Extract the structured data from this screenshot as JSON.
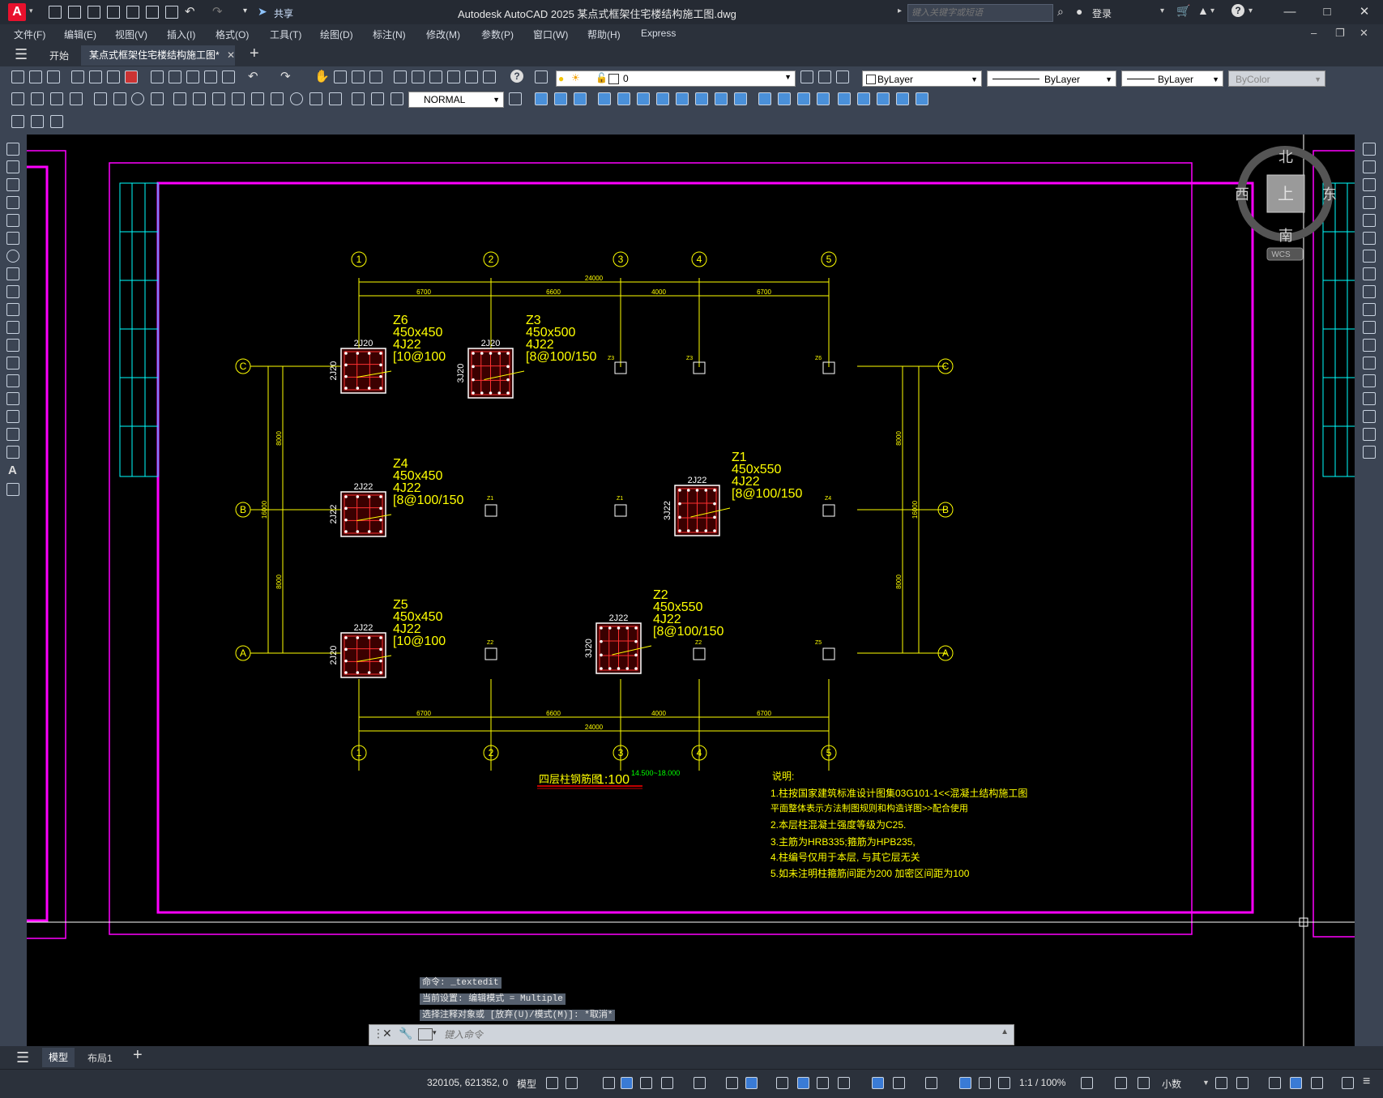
{
  "titlebar": {
    "app_logo": "A",
    "share_label": "共享",
    "title": "Autodesk AutoCAD 2025    某点式框架住宅楼结构施工图.dwg",
    "search_placeholder": "键入关键字或短语",
    "login_label": "登录"
  },
  "menu": [
    "文件(F)",
    "编辑(E)",
    "视图(V)",
    "插入(I)",
    "格式(O)",
    "工具(T)",
    "绘图(D)",
    "标注(N)",
    "修改(M)",
    "参数(P)",
    "窗口(W)",
    "帮助(H)",
    "Express"
  ],
  "tabs": {
    "start": "开始",
    "document": "某点式框架住宅楼结构施工图*"
  },
  "toolbar": {
    "layer_value": "0",
    "color_value": "ByLayer",
    "linetype_value": "ByLayer",
    "lineweight_value": "ByLayer",
    "plotstyle_value": "ByColor",
    "dimstyle_value": "NORMAL"
  },
  "viewcube": {
    "north": "北",
    "south": "南",
    "east": "东",
    "west": "西",
    "face": "上",
    "wcs": "WCS"
  },
  "drawing": {
    "axis_numbers": [
      "1",
      "2",
      "3",
      "4",
      "5"
    ],
    "axis_letters": [
      "C",
      "B",
      "A"
    ],
    "dims_top": [
      "24000",
      "6700",
      "6600",
      "4000",
      "6700"
    ],
    "dims_bottom": [
      "6700",
      "6600",
      "4000",
      "6700",
      "24000"
    ],
    "dims_left": [
      "8000",
      "16000",
      "8000"
    ],
    "dims_right": [
      "8000",
      "16000",
      "8000"
    ],
    "columns": [
      {
        "id": "Z6",
        "lines": [
          "Z6",
          "450x450",
          "4J22",
          "[10@100"
        ],
        "top": "2J20",
        "side": "2J20"
      },
      {
        "id": "Z3",
        "lines": [
          "Z3",
          "450x500",
          "4J22",
          "[8@100/150"
        ],
        "top": "2J20",
        "side": "3J20"
      },
      {
        "id": "Z4",
        "lines": [
          "Z4",
          "450x450",
          "4J22",
          "[8@100/150"
        ],
        "top": "2J22",
        "side": "2J22"
      },
      {
        "id": "Z1",
        "lines": [
          "Z1",
          "450x550",
          "4J22",
          "[8@100/150"
        ],
        "top": "2J22",
        "side": "3J22"
      },
      {
        "id": "Z5",
        "lines": [
          "Z5",
          "450x450",
          "4J22",
          "[10@100"
        ],
        "top": "2J22",
        "side": "2J20"
      },
      {
        "id": "Z2",
        "lines": [
          "Z2",
          "450x550",
          "4J22",
          "[8@100/150"
        ],
        "top": "2J22",
        "side": "3J20"
      }
    ],
    "small_labels": [
      "Z3",
      "Z3",
      "Z6",
      "Z1",
      "Z1",
      "Z4",
      "Z2",
      "Z2",
      "Z5"
    ],
    "title": "四层柱钢筋图",
    "scale": "1:100",
    "elevation": "14.500~18.000",
    "notes": [
      "说明:",
      "1.柱按国家建筑标准设计图集03G101-1<<混凝土结构施工图",
      "  平面整体表示方法制图规则和构造详图>>配合使用",
      "2.本层柱混凝土强度等级为C25.",
      "3.主筋为HRB335;箍筋为HPB235,",
      "4.柱编号仅用于本层, 与其它层无关",
      "5.如未注明柱箍筋间距为200 加密区间距为100"
    ]
  },
  "command": {
    "history": [
      "命令: _textedit",
      "当前设置: 编辑模式 = Multiple",
      "选择注释对象或 [放弃(U)/模式(M)]: *取消*"
    ],
    "input_placeholder": "键入命令"
  },
  "layout_tabs": {
    "model": "模型",
    "layout1": "布局1"
  },
  "statusbar": {
    "coords": "320105, 621352, 0",
    "model_label": "模型",
    "scale_label": "1:1 / 100%",
    "units_label": "小数"
  },
  "colors": {
    "magenta": "#ff00ff",
    "cyan": "#00ffff",
    "yellow": "#ffff00",
    "red": "#ff0000",
    "accent": "#e8112d"
  }
}
